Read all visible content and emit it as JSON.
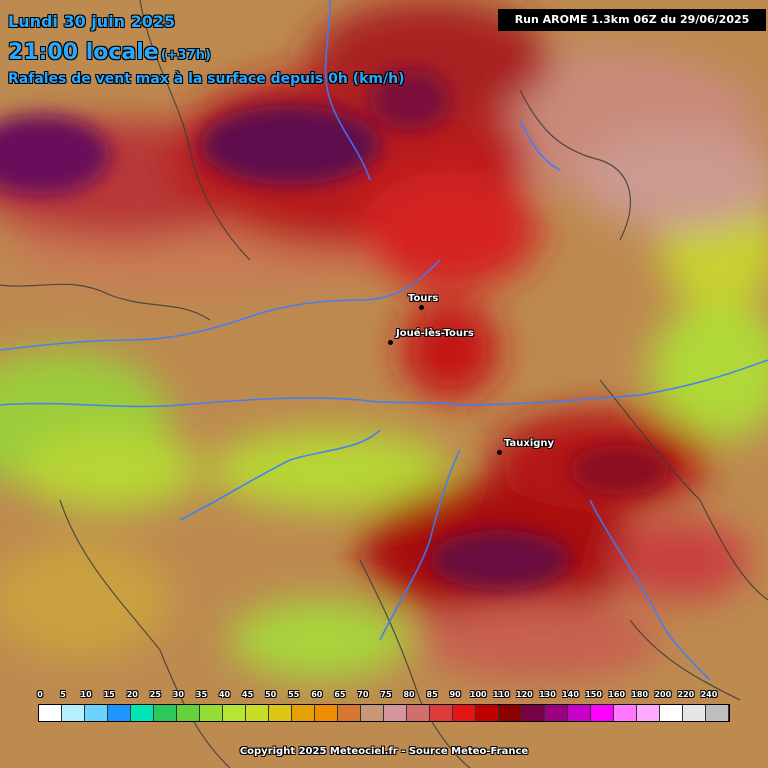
{
  "header": {
    "date": "Lundi 30 juin 2025",
    "time": "21:00 locale",
    "offset": "(+37h)",
    "subtitle": "Rafales de vent max à la surface depuis 0h (km/h)",
    "run": "Run AROME 1.3km 06Z du 29/06/2025"
  },
  "cities": [
    {
      "name": "Tours"
    },
    {
      "name": "Joué-lès-Tours"
    },
    {
      "name": "Tauxigny"
    }
  ],
  "legend": {
    "labels": [
      "0",
      "5",
      "10",
      "15",
      "20",
      "25",
      "30",
      "35",
      "40",
      "45",
      "50",
      "55",
      "60",
      "65",
      "70",
      "75",
      "80",
      "85",
      "90",
      "100",
      "110",
      "120",
      "130",
      "140",
      "150",
      "160",
      "180",
      "200",
      "220",
      "240"
    ],
    "colors": [
      "#ffffff",
      "#b4f0ff",
      "#6ed2ff",
      "#1e96ff",
      "#00e6b4",
      "#2dc85a",
      "#64d23c",
      "#96dc32",
      "#b4e632",
      "#c8dc28",
      "#dcc814",
      "#e6a000",
      "#f08c00",
      "#d77832",
      "#c89678",
      "#d2969b",
      "#d26e6e",
      "#dc3c3c",
      "#e61414",
      "#be0000",
      "#8c0000",
      "#780046",
      "#9b0082",
      "#c800c8",
      "#ff00ff",
      "#ff78ff",
      "#ffaaff",
      "#ffffff",
      "#e6e6e6",
      "#bebebe"
    ]
  },
  "footer": {
    "copyright": "Copyright 2025 Meteociel.fr - Source Meteo-France"
  }
}
